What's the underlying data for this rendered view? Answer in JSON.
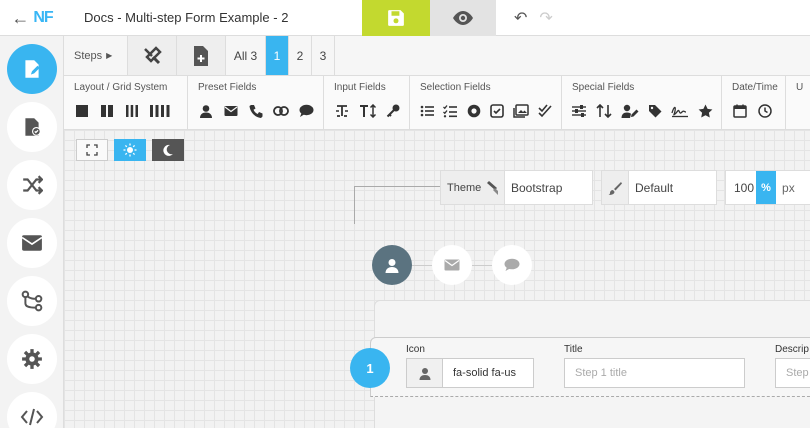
{
  "app": {
    "logo": "NF",
    "title": "Docs - Multi-step Form Example - 2"
  },
  "sidebar": {
    "items": [
      {
        "name": "form-editor",
        "icon": "file-pen-icon",
        "active": true
      },
      {
        "name": "form-settings",
        "icon": "file-check-icon"
      },
      {
        "name": "conditional-logic",
        "icon": "shuffle-icon"
      },
      {
        "name": "email",
        "icon": "envelope-icon"
      },
      {
        "name": "steps",
        "icon": "diagram-icon"
      },
      {
        "name": "settings",
        "icon": "gear-icon"
      },
      {
        "name": "code",
        "icon": "code-icon"
      }
    ]
  },
  "steps_bar": {
    "label": "Steps",
    "all_label": "All 3",
    "steps": [
      "1",
      "2",
      "3"
    ],
    "active_step": "1"
  },
  "field_groups": [
    {
      "label": "Layout / Grid System",
      "icons": [
        "col-1-icon",
        "col-2-icon",
        "col-3-icon",
        "col-4-icon"
      ]
    },
    {
      "label": "Preset Fields",
      "icons": [
        "user-icon",
        "envelope-icon",
        "phone-icon",
        "link-icon",
        "comment-icon"
      ]
    },
    {
      "label": "Input Fields",
      "icons": [
        "text-cursor-icon",
        "text-height-icon",
        "key-icon"
      ]
    },
    {
      "label": "Selection Fields",
      "icons": [
        "list-icon",
        "list-check-icon",
        "radio-icon",
        "checkbox-icon",
        "image-icon",
        "double-check-icon"
      ]
    },
    {
      "label": "Special Fields",
      "icons": [
        "sliders-icon",
        "sort-icon",
        "user-edit-icon",
        "tag-icon",
        "signature-icon",
        "star-icon"
      ]
    },
    {
      "label": "Date/Time",
      "icons": [
        "calendar-icon",
        "clock-icon"
      ]
    },
    {
      "label": "U",
      "icons": [
        "upload-icon"
      ]
    }
  ],
  "theme_bar": {
    "theme_label": "Theme",
    "theme_value": "Bootstrap",
    "style_value": "Default",
    "width_value": "100",
    "pct_label": "%",
    "px_label": "px"
  },
  "step_nav": {
    "icons": [
      "user-icon",
      "envelope-icon",
      "comment-icon"
    ],
    "active_index": 0
  },
  "step_editor": {
    "number": "1",
    "icon_label": "Icon",
    "icon_value": "fa-solid fa-us",
    "title_label": "Title",
    "title_placeholder": "Step 1 title",
    "description_label": "Descrip",
    "description_placeholder": "Step"
  },
  "colors": {
    "accent": "#39b5f0",
    "save": "#c3d92f",
    "step_active": "#5b7380"
  }
}
